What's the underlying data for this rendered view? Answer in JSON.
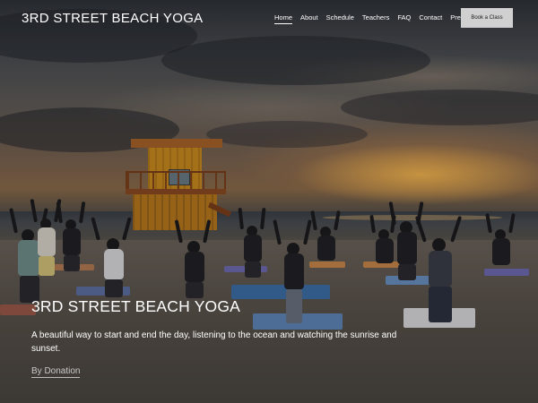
{
  "brand": {
    "name": "3RD STREET BEACH YOGA"
  },
  "nav": {
    "items": [
      "Home",
      "About",
      "Schedule",
      "Teachers",
      "FAQ",
      "Contact",
      "Press"
    ],
    "active": "Home",
    "cta_label": "Book a Class"
  },
  "hero": {
    "title": "3RD STREET BEACH YOGA",
    "description": "A beautiful way to start and end the day, listening to the ocean and watching the sunrise and sunset.",
    "link_label": "By Donation"
  },
  "colors": {
    "text": "#ffffff",
    "cta_background": "#d0d0d0",
    "cta_text": "#1a1a1a"
  }
}
